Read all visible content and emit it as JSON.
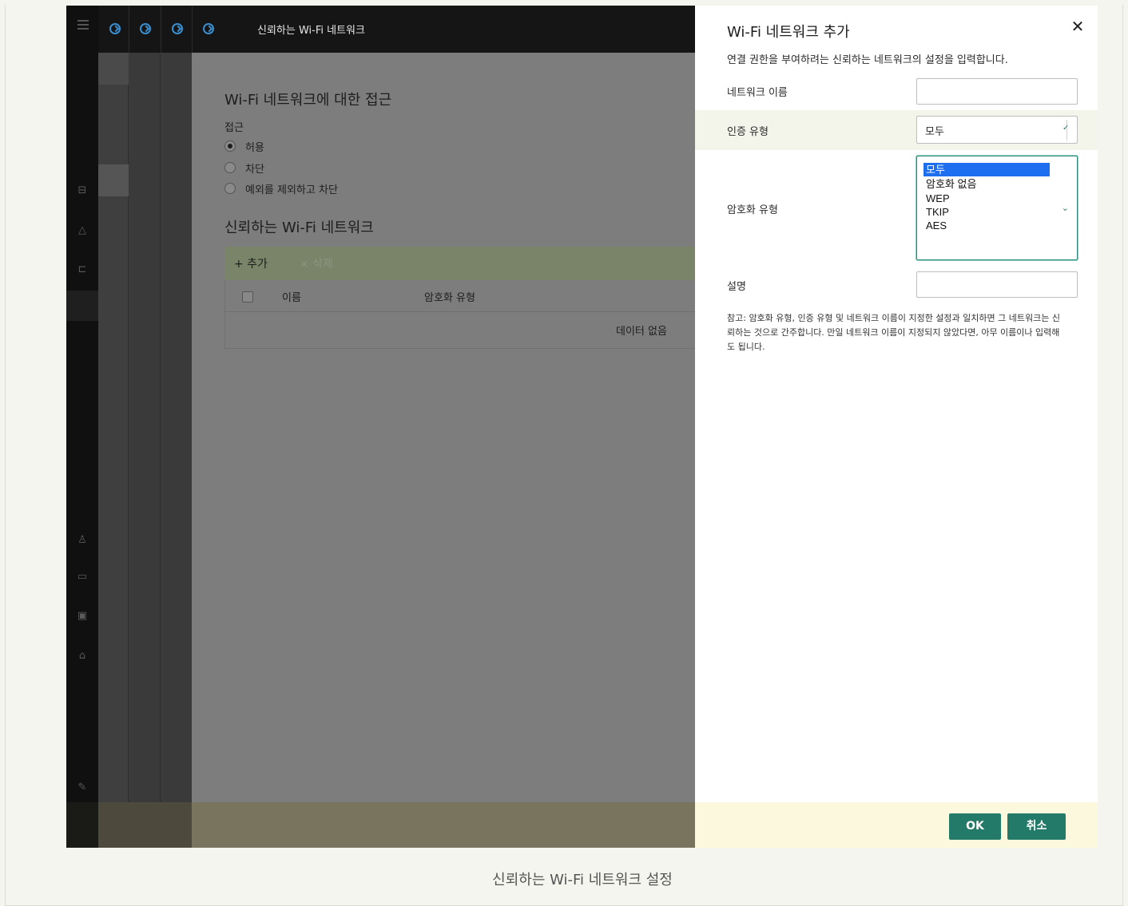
{
  "topbar": {
    "title": "신뢰하는 Wi-Fi 네트워크"
  },
  "background_page": {
    "access_heading": "Wi-Fi 네트워크에 대한 접근",
    "access_label": "접근",
    "radios": [
      {
        "label": "허용",
        "checked": true
      },
      {
        "label": "차단",
        "checked": false
      },
      {
        "label": "예외를 제외하고 차단",
        "checked": false
      }
    ],
    "trusted_heading": "신뢰하는 Wi-Fi 네트워크",
    "toolbar": {
      "add_label": "+ 추가",
      "delete_label": "× 삭제"
    },
    "table": {
      "columns": [
        "이름",
        "암호화 유형"
      ],
      "empty_text": "데이터 없음"
    }
  },
  "drawer": {
    "title": "Wi-Fi 네트워크 추가",
    "subtitle": "연결 권한을 부여하려는 신뢰하는 네트워크의 설정을 입력합니다.",
    "fields": {
      "network_name_label": "네트워크 이름",
      "network_name_value": "",
      "auth_type_label": "인증 유형",
      "auth_type_value": "모두",
      "encryption_type_label": "암호화 유형",
      "encryption_options": [
        "모두",
        "암호화 없음",
        "WEP",
        "TKIP",
        "AES"
      ],
      "encryption_selected": "모두",
      "description_label": "설명",
      "description_value": ""
    },
    "note": "참고: 암호화 유형, 인증 유형 및 네트워크 이름이 지정한 설정과 일치하면 그 네트워크는 신뢰하는 것으로 간주합니다. 만일 네트워크 이름이 지정되지 않았다면, 아무 이름이나 입력해도 됩니다.",
    "buttons": {
      "ok": "OK",
      "cancel": "취소"
    }
  },
  "caption": "신뢰하는 Wi-Fi 네트워크 설정",
  "colors": {
    "accent": "#237a68",
    "breadcrumb": "#3a8fd0",
    "selected_option": "#1e6ff0",
    "footer_bg": "#fbf8de"
  },
  "icons": [
    "menu-icon",
    "breadcrumb-icon",
    "close-icon",
    "chevron-down-icon",
    "plus-icon"
  ]
}
